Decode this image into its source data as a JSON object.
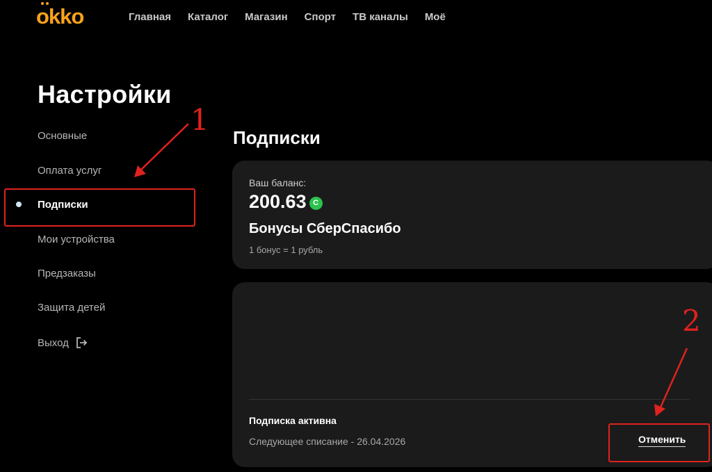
{
  "header": {
    "logo": "okko",
    "nav": [
      "Главная",
      "Каталог",
      "Магазин",
      "Спорт",
      "ТВ каналы",
      "Моё"
    ]
  },
  "settings": {
    "title": "Настройки",
    "menu": [
      "Основные",
      "Оплата услуг",
      "Подписки",
      "Мои устройства",
      "Предзаказы",
      "Защита детей",
      "Выход"
    ],
    "active_item": "Подписки"
  },
  "subscriptions": {
    "title": "Подписки",
    "balance_label": "Ваш баланс:",
    "balance_value": "200.63",
    "bonus_title": "Бонусы СберСпасибо",
    "bonus_rate": "1 бонус = 1 рубль",
    "status": "Подписка активна",
    "next_charge": "Следующее списание - 26.04.2026",
    "cancel_label": "Отменить"
  },
  "annotations": {
    "label_1": "1",
    "label_2": "2",
    "color": "#e0221e"
  },
  "colors": {
    "brand": "#f7a21b",
    "background": "#000000",
    "card": "#1b1b1b",
    "sber_green": "#2bc24e"
  },
  "icons": [
    "logout-icon",
    "sber-spasibo-icon"
  ]
}
